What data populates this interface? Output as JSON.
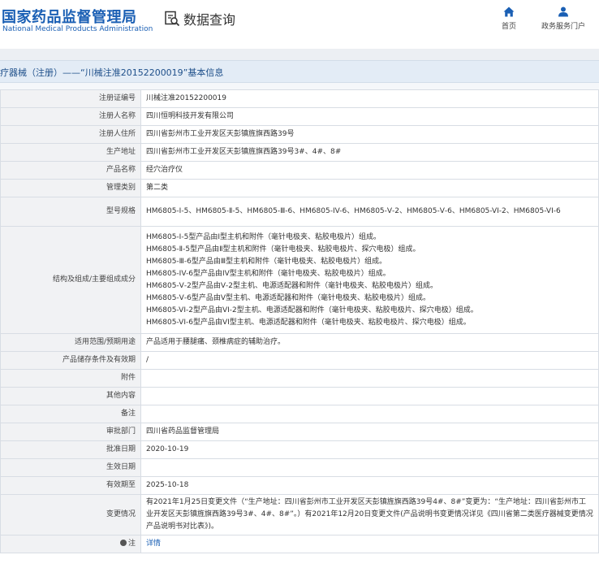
{
  "header": {
    "site_title_cn": "国家药品监督管理局",
    "site_title_en": "National Medical Products Administration",
    "query_label": "数据查询",
    "nav": [
      {
        "label": "首页",
        "icon": "home-icon"
      },
      {
        "label": "政务服务门户",
        "icon": "user-icon"
      }
    ]
  },
  "title": "疗器械（注册）——“川械注准20152200019”基本信息",
  "fields": [
    {
      "label": "注册证编号",
      "value": "川械注准20152200019"
    },
    {
      "label": "注册人名称",
      "value": "四川恒明科技开发有限公司"
    },
    {
      "label": "注册人住所",
      "value": "四川省彭州市工业开发区天彭镇旌旗西路39号"
    },
    {
      "label": "生产地址",
      "value": "四川省彭州市工业开发区天彭镇旌旗西路39号3#、4#、8#"
    },
    {
      "label": "产品名称",
      "value": "经穴治疗仪"
    },
    {
      "label": "管理类别",
      "value": "第二类"
    },
    {
      "label": "型号规格",
      "value": "HM6805-Ⅰ-5、HM6805-Ⅱ-5、HM6805-Ⅲ-6、HM6805-IV-6、HM6805-Ⅴ-2、HM6805-Ⅴ-6、HM6805-VI-2、HM6805-VI-6"
    },
    {
      "label": "结构及组成/主要组成成分",
      "lines": [
        "HM6805-Ⅰ-5型产品由Ⅰ型主机和附件（毫针电极夹、粘胶电极片）组成。",
        "HM6805-Ⅱ-5型产品由Ⅱ型主机和附件（毫针电极夹、粘胶电极片、探穴电极）组成。",
        "HM6805-Ⅲ-6型产品由Ⅲ型主机和附件（毫针电极夹、粘胶电极片）组成。",
        "HM6805-IV-6型产品由IV型主机和附件（毫针电极夹、粘胶电极片）组成。",
        "HM6805-Ⅴ-2型产品由Ⅴ-2型主机、电源适配器和附件（毫针电极夹、粘胶电极片）组成。",
        "HM6805-Ⅴ-6型产品由Ⅴ型主机、电源适配器和附件（毫针电极夹、粘胶电极片）组成。",
        "HM6805-VI-2型产品由VI-2型主机、电源适配器和附件（毫针电极夹、粘胶电极片、探穴电极）组成。",
        "HM6805-VI-6型产品由VI型主机、电源适配器和附件（毫针电极夹、粘胶电极片、探穴电极）组成。"
      ]
    },
    {
      "label": "适用范围/预期用途",
      "value": "产品适用于腰腿痛、颈椎病症的辅助治疗。"
    },
    {
      "label": "产品储存条件及有效期",
      "value": "/"
    },
    {
      "label": "附件",
      "value": ""
    },
    {
      "label": "其他内容",
      "value": ""
    },
    {
      "label": "备注",
      "value": ""
    },
    {
      "label": "审批部门",
      "value": "四川省药品监督管理局"
    },
    {
      "label": "批准日期",
      "value": "2020-10-19"
    },
    {
      "label": "生效日期",
      "value": ""
    },
    {
      "label": "有效期至",
      "value": "2025-10-18"
    },
    {
      "label": "变更情况",
      "value": "有2021年1月25日变更文件（“生产地址：四川省彭州市工业开发区天彭镇旌旗西路39号4#、8#”变更为：“生产地址：四川省彭州市工业开发区天彭镇旌旗西路39号3#、4#、8#”。）有2021年12月20日变更文件(产品说明书变更情况详见《四川省第二类医疗器械变更情况产品说明书对比表》)。"
    },
    {
      "label": "注",
      "value": "详情"
    }
  ]
}
